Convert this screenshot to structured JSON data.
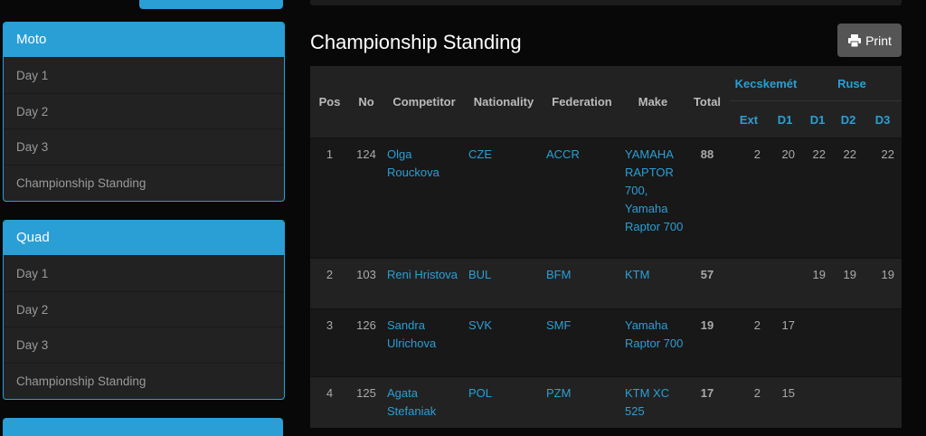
{
  "sidebar": {
    "moto": {
      "title": "Moto",
      "items": [
        {
          "label": "Day 1"
        },
        {
          "label": "Day 2"
        },
        {
          "label": "Day 3"
        },
        {
          "label": "Championship Standing"
        }
      ]
    },
    "quad": {
      "title": "Quad",
      "items": [
        {
          "label": "Day 1"
        },
        {
          "label": "Day 2"
        },
        {
          "label": "Day 3"
        },
        {
          "label": "Championship Standing"
        }
      ]
    }
  },
  "main": {
    "title": "Championship Standing",
    "print_label": "Print",
    "table": {
      "headers": {
        "pos": "Pos",
        "no": "No",
        "competitor": "Competitor",
        "nationality": "Nationality",
        "federation": "Federation",
        "make": "Make",
        "total": "Total",
        "group1": "Kecskemét",
        "group2": "Ruse",
        "g1_ext": "Ext",
        "g1_d1": "D1",
        "g2_d1": "D1",
        "g2_d2": "D2",
        "g2_d3": "D3"
      },
      "rows": [
        {
          "pos": "1",
          "no": "124",
          "competitor": "Olga Rouckova",
          "nationality": "CZE",
          "federation": "ACCR",
          "make": "YAMAHA RAPTOR 700, Yamaha Raptor 700",
          "total": "88",
          "g1_ext": "2",
          "g1_d1": "20",
          "g2_d1": "22",
          "g2_d2": "22",
          "g2_d3": "22"
        },
        {
          "pos": "2",
          "no": "103",
          "competitor": "Reni Hristova",
          "nationality": "BUL",
          "federation": "BFM",
          "make": "KTM",
          "total": "57",
          "g1_ext": "",
          "g1_d1": "",
          "g2_d1": "19",
          "g2_d2": "19",
          "g2_d3": "19"
        },
        {
          "pos": "3",
          "no": "126",
          "competitor": "Sandra Ulrichova",
          "nationality": "SVK",
          "federation": "SMF",
          "make": "Yamaha Raptor 700",
          "total": "19",
          "g1_ext": "2",
          "g1_d1": "17",
          "g2_d1": "",
          "g2_d2": "",
          "g2_d3": ""
        },
        {
          "pos": "4",
          "no": "125",
          "competitor": "Agata Stefaniak",
          "nationality": "POL",
          "federation": "PZM",
          "make": "KTM XC 525",
          "total": "17",
          "g1_ext": "2",
          "g1_d1": "15",
          "g2_d1": "",
          "g2_d2": "",
          "g2_d3": ""
        }
      ]
    }
  },
  "colors": {
    "accent": "#2a9fd6",
    "background": "#080808",
    "panel": "#222222"
  }
}
